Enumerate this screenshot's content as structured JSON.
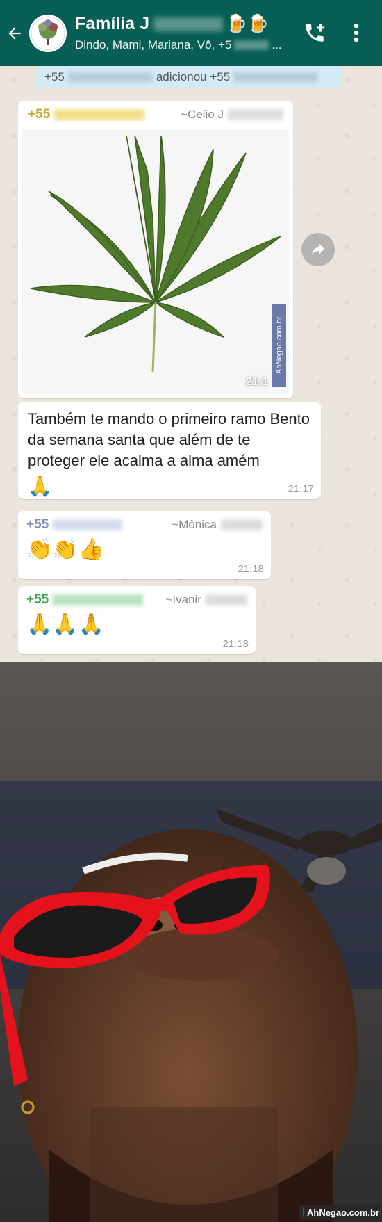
{
  "header": {
    "title": "Família J",
    "title_emoji": "🍺🍺",
    "subtitle": "Dindo, Mami, Mariana, Vô, +5",
    "subtitle_tail": "...",
    "back_icon": "back-arrow-icon",
    "call_icon": "add-call-icon",
    "menu_icon": "more-vert-icon"
  },
  "system_message": {
    "prefix": "+55",
    "middle": "adicionou +55"
  },
  "messages": [
    {
      "sender_phone": "+55",
      "sender_name": "~Celio J",
      "sender_color": "#c9a227",
      "type": "image",
      "image": "cannabis-leaf",
      "time": "21:1",
      "watermark": "AhNegao.com.br"
    },
    {
      "type": "text",
      "text": "Também te mando o primeiro ramo Bento da semana santa que além de te proteger ele acalma a alma amém",
      "emoji": "🙏",
      "time": "21:17"
    },
    {
      "sender_phone": "+55",
      "sender_name": "~Mônica",
      "sender_color": "#7a8fb5",
      "type": "emoji",
      "emoji": "👏👏👍",
      "time": "21:18"
    },
    {
      "sender_phone": "+55",
      "sender_name": "~Ivanir",
      "sender_color": "#3aa64a",
      "type": "emoji",
      "emoji": "🙏🙏🙏",
      "time": "21:18"
    }
  ],
  "photo": {
    "subject": "person-with-red-sunglasses-selfie",
    "badge_text": "AhNegao.com.br"
  },
  "colors": {
    "header": "#075e54",
    "chat_bg": "#ece5dd",
    "system_bg": "#d4eaf4"
  }
}
